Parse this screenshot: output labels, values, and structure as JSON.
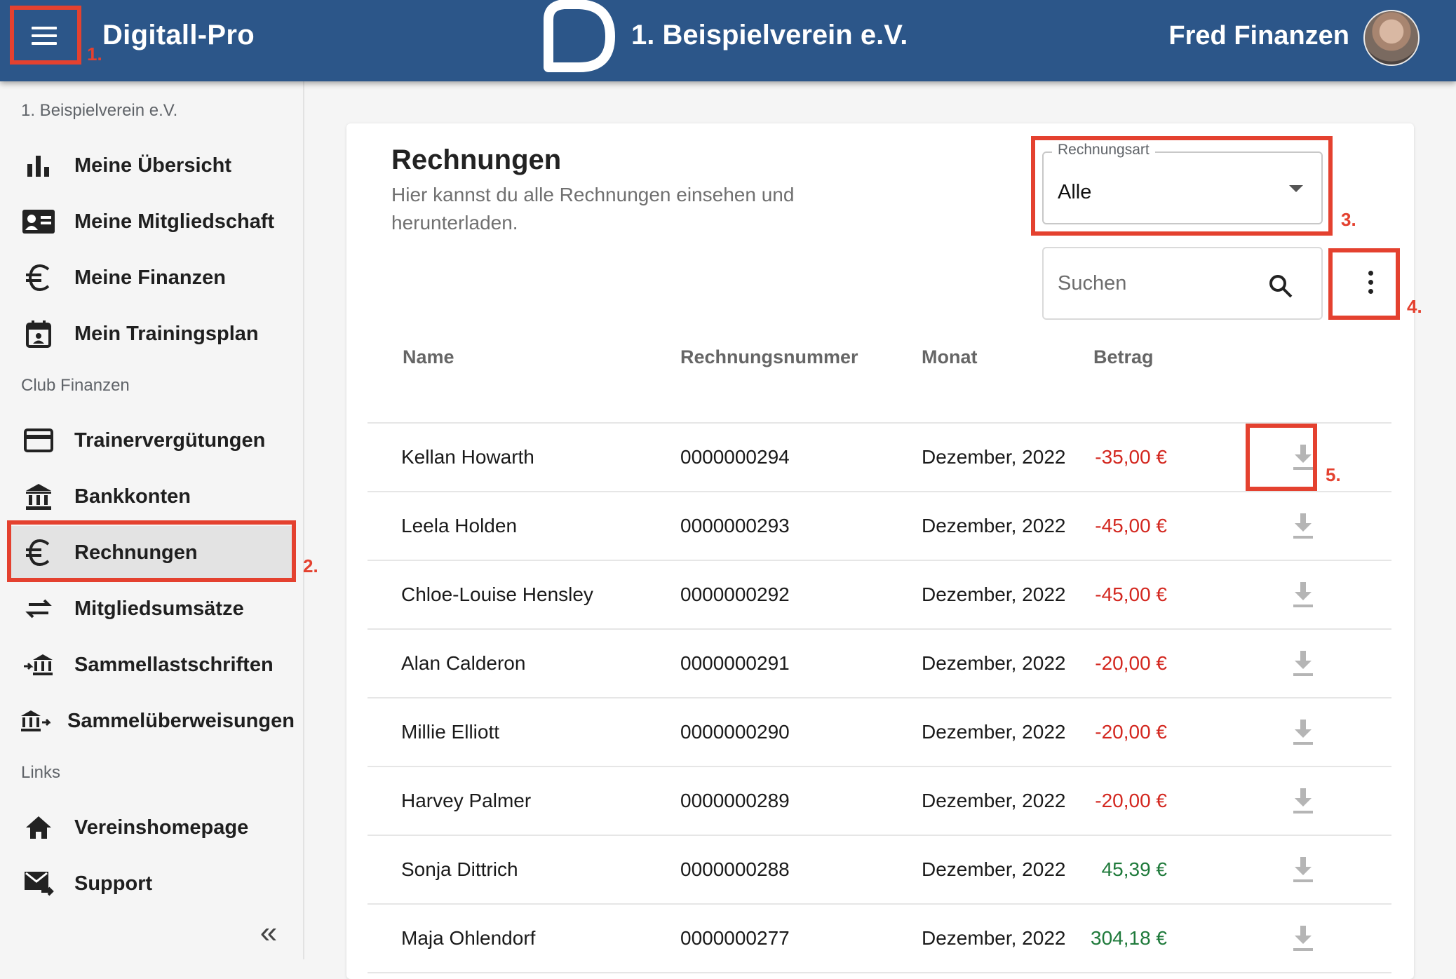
{
  "header": {
    "app_title": "Digitall-Pro",
    "club_title": "1. Beispielverein e.V.",
    "user_name": "Fred Finanzen",
    "color": "#2c5689"
  },
  "sidebar": {
    "club_name": "1. Beispielverein e.V.",
    "items_top": [
      {
        "label": "Meine Übersicht",
        "icon": "bar-chart-icon"
      },
      {
        "label": "Meine Mitgliedschaft",
        "icon": "id-card-icon"
      },
      {
        "label": "Meine Finanzen",
        "icon": "euro-icon"
      },
      {
        "label": "Mein Trainingsplan",
        "icon": "calendar-icon"
      }
    ],
    "section_finance": "Club Finanzen",
    "items_finance": [
      {
        "label": "Trainervergütungen",
        "icon": "credit-card-icon"
      },
      {
        "label": "Bankkonten",
        "icon": "bank-icon"
      },
      {
        "label": "Rechnungen",
        "icon": "euro-icon",
        "active": true
      },
      {
        "label": "Mitgliedsumsätze",
        "icon": "swap-arrows-icon"
      },
      {
        "label": "Sammellastschriften",
        "icon": "bank-arrow-in-icon"
      },
      {
        "label": "Sammelüberweisungen",
        "icon": "bank-arrow-out-icon"
      }
    ],
    "section_links": "Links",
    "items_links": [
      {
        "label": "Vereinshomepage",
        "icon": "home-icon"
      },
      {
        "label": "Support",
        "icon": "mail-forward-icon"
      }
    ],
    "collapse_label": "«"
  },
  "main": {
    "title": "Rechnungen",
    "subtitle": "Hier kannst du alle Rechnungen einsehen und herunterladen.",
    "filter": {
      "label": "Rechnungsart",
      "value": "Alle"
    },
    "search": {
      "placeholder": "Suchen"
    },
    "table": {
      "headers": [
        "Name",
        "Rechnungsnummer",
        "Monat",
        "Betrag"
      ],
      "rows": [
        {
          "name": "Kellan Howarth",
          "number": "0000000294",
          "month": "Dezember, 2022",
          "amount": "-35,00 €",
          "sign": "neg"
        },
        {
          "name": "Leela Holden",
          "number": "0000000293",
          "month": "Dezember, 2022",
          "amount": "-45,00 €",
          "sign": "neg"
        },
        {
          "name": "Chloe-Louise Hensley",
          "number": "0000000292",
          "month": "Dezember, 2022",
          "amount": "-45,00 €",
          "sign": "neg"
        },
        {
          "name": "Alan Calderon",
          "number": "0000000291",
          "month": "Dezember, 2022",
          "amount": "-20,00 €",
          "sign": "neg"
        },
        {
          "name": "Millie Elliott",
          "number": "0000000290",
          "month": "Dezember, 2022",
          "amount": "-20,00 €",
          "sign": "neg"
        },
        {
          "name": "Harvey Palmer",
          "number": "0000000289",
          "month": "Dezember, 2022",
          "amount": "-20,00 €",
          "sign": "neg"
        },
        {
          "name": "Sonja Dittrich",
          "number": "0000000288",
          "month": "Dezember, 2022",
          "amount": "45,39 €",
          "sign": "pos"
        },
        {
          "name": "Maja Ohlendorf",
          "number": "0000000277",
          "month": "Dezember, 2022",
          "amount": "304,18 €",
          "sign": "pos"
        }
      ]
    }
  },
  "annotations": [
    "1.",
    "2.",
    "3.",
    "4.",
    "5."
  ],
  "colors": {
    "negative": "#d3271f",
    "positive": "#1f7a3b",
    "annotation": "#e4412f"
  }
}
